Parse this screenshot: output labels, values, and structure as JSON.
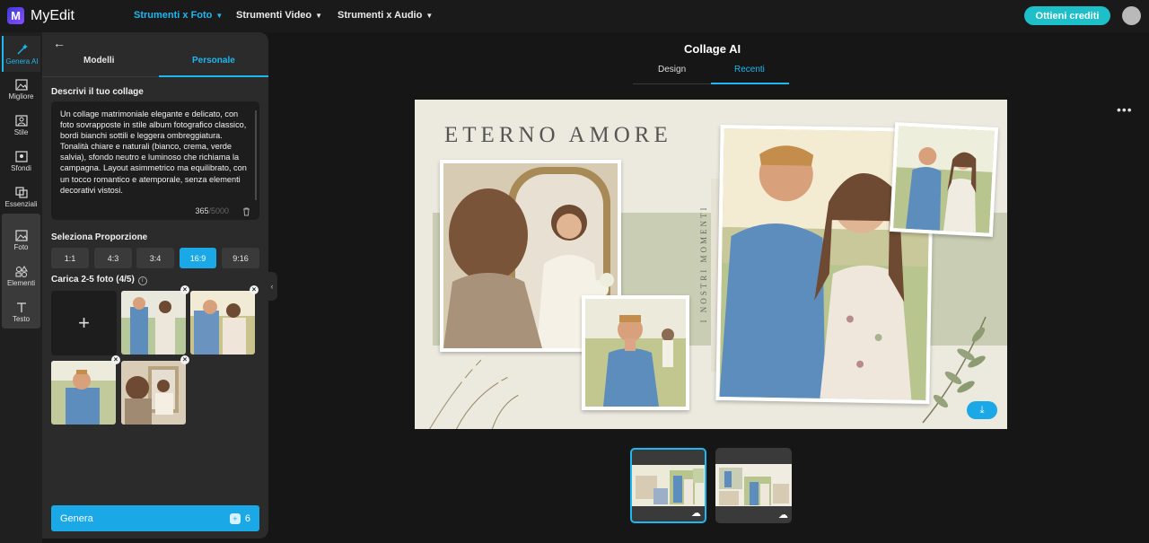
{
  "topbar": {
    "logo_mark": "M",
    "app_name": "MyEdit",
    "nav": [
      "Strumenti x Foto",
      "Strumenti Video",
      "Strumenti x Audio"
    ],
    "credits_button": "Ottieni crediti"
  },
  "rail": {
    "items": [
      {
        "label": "Genera AI",
        "icon": "magic-wand-icon"
      },
      {
        "label": "Migliore",
        "icon": "image-enhance-icon"
      },
      {
        "label": "Stile",
        "icon": "style-icon"
      },
      {
        "label": "Sfondi",
        "icon": "background-icon"
      },
      {
        "label": "Essenziali",
        "icon": "crop-icon"
      },
      {
        "label": "Foto",
        "icon": "photo-icon"
      },
      {
        "label": "Elementi",
        "icon": "shapes-icon"
      },
      {
        "label": "Testo",
        "icon": "text-icon"
      }
    ]
  },
  "panel": {
    "tabs": [
      "Modelli",
      "Personale"
    ],
    "active_tab": "Personale",
    "prompt_label": "Descrivi il tuo collage",
    "prompt_text": "Un collage matrimoniale elegante e delicato, con foto sovrapposte in stile album fotografico classico, bordi bianchi sottili e leggera ombreggiatura. Tonalità chiare e naturali (bianco, crema, verde salvia), sfondo neutro e luminoso che richiama la campagna. Layout asimmetrico ma equilibrato, con un tocco romantico e atemporale, senza elementi decorativi vistosi.",
    "char_count": "365",
    "char_max": "/5000",
    "ratio_label": "Seleziona Proporzione",
    "ratios": [
      "1:1",
      "4:3",
      "3:4",
      "16:9",
      "9:16"
    ],
    "selected_ratio": "16:9",
    "upload_label": "Carica 2-5 foto (4/5)",
    "info_glyph": "i",
    "add_glyph": "+",
    "remove_glyph": "×",
    "generate_label": "Genera",
    "generate_cost": "6",
    "coin_glyph": "+",
    "collapse_glyph": "‹"
  },
  "main": {
    "title": "Collage AI",
    "tabs": [
      "Design",
      "Recenti"
    ],
    "active_tab": "Recenti",
    "more_glyph": "•••",
    "collage_title": "ETERNO AMORE",
    "collage_subtitle": "I NOSTRI MOMENTI",
    "download_glyph": "⤓",
    "cloud_glyph": "☁"
  },
  "colors": {
    "accent": "#1fb7f0",
    "primary_button": "#1aa8e6",
    "credits_button": "#1dbfc9",
    "sage": "#c8cdb3"
  }
}
